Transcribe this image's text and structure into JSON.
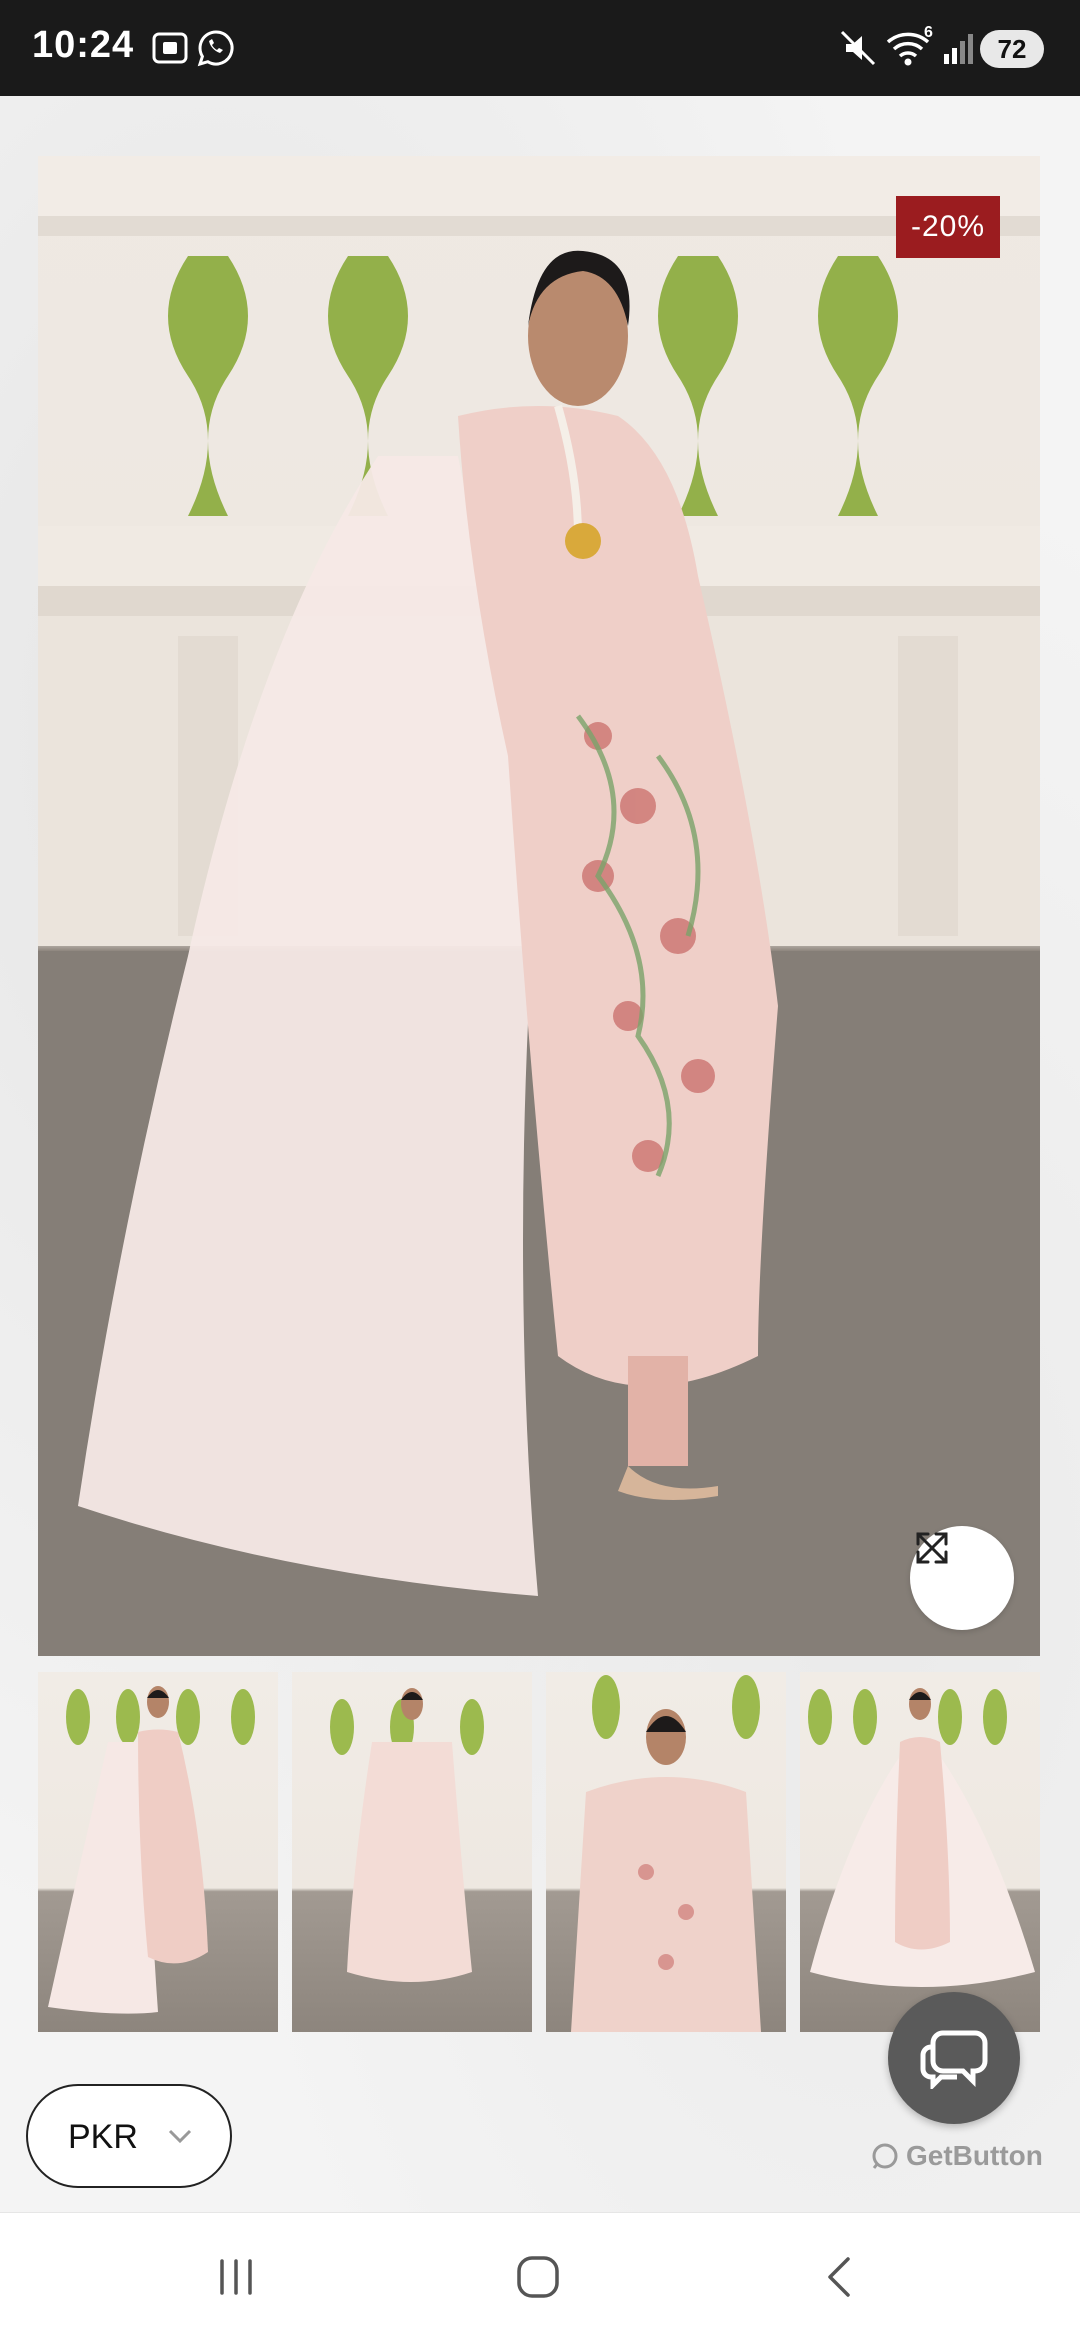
{
  "status_bar": {
    "time": "10:24",
    "icons": [
      "screenshot-icon",
      "whatsapp-icon",
      "mute-icon",
      "wifi-icon",
      "signal-icon"
    ],
    "wifi_label": "6",
    "battery": "72"
  },
  "product": {
    "discount_badge": "-20%",
    "main_image_alt": "model-wearing-pink-embroidered-suit",
    "thumbnails": [
      {
        "name": "thumbnail-1"
      },
      {
        "name": "thumbnail-2"
      },
      {
        "name": "thumbnail-3"
      },
      {
        "name": "thumbnail-4"
      }
    ]
  },
  "currency": {
    "selected": "PKR"
  },
  "chat": {
    "brand": "GetButton"
  },
  "colors": {
    "badge": "#9b1c1f",
    "status_bar": "#1a1a1a",
    "chat_button": "#5a5a5a"
  },
  "nav": {
    "icons": [
      "recent-apps-icon",
      "home-icon",
      "back-icon"
    ]
  }
}
